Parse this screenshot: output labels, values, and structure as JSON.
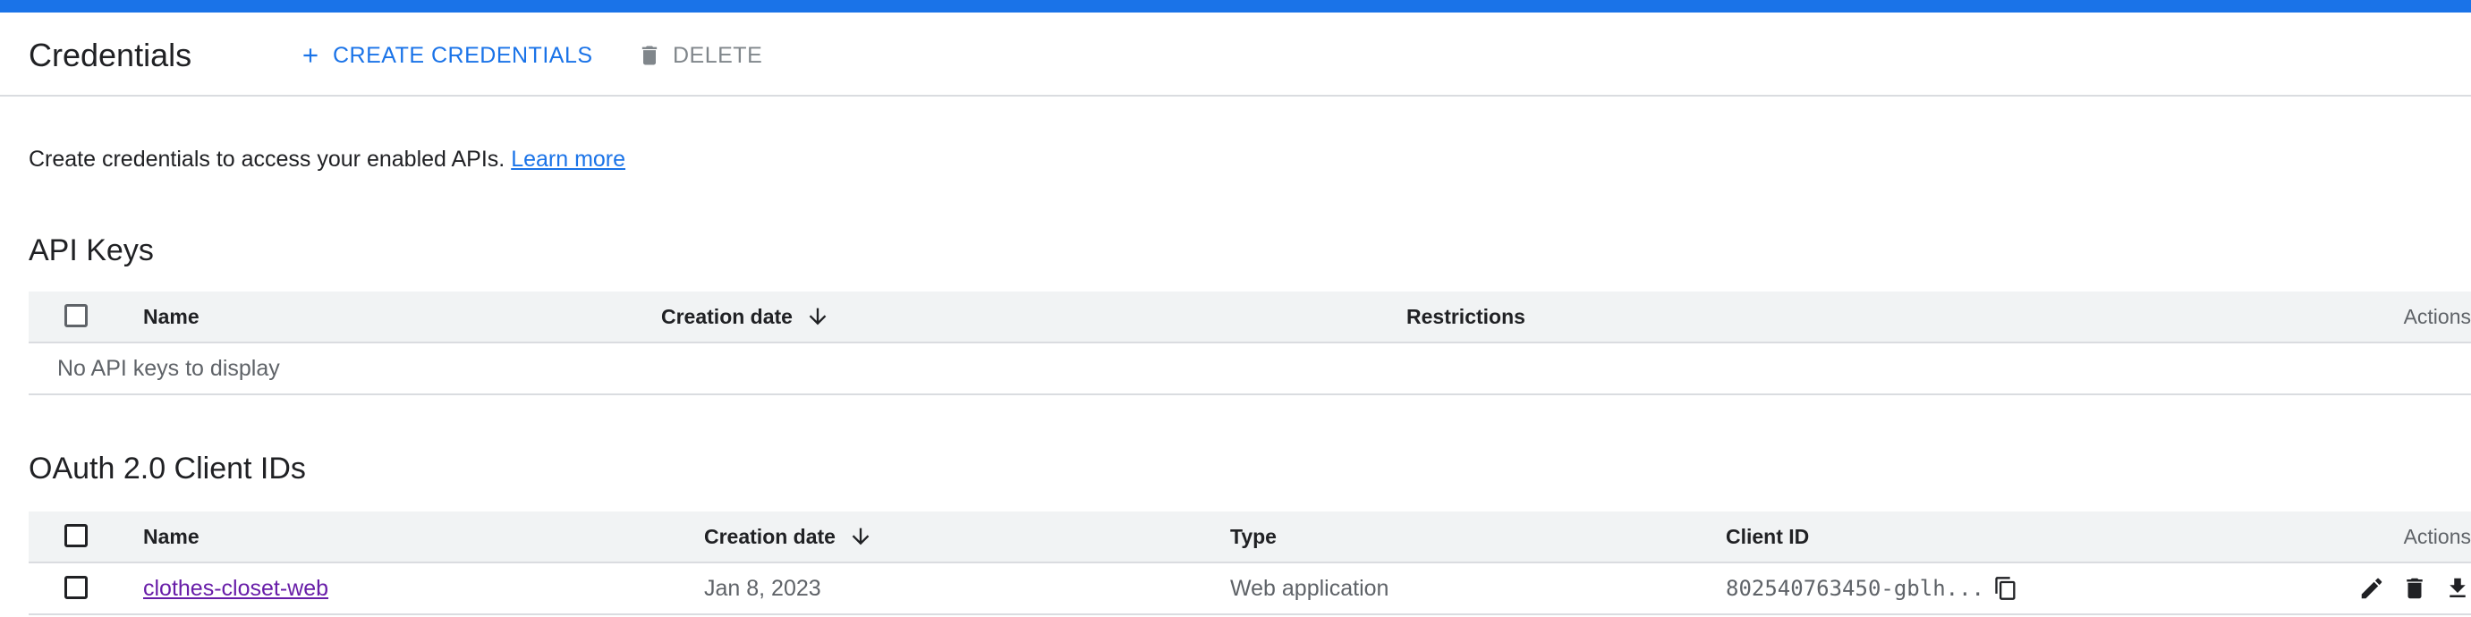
{
  "header": {
    "title": "Credentials",
    "create_label": "CREATE CREDENTIALS",
    "delete_label": "DELETE"
  },
  "intro": {
    "text": "Create credentials to access your enabled APIs. ",
    "link": "Learn more"
  },
  "api_keys": {
    "title": "API Keys",
    "columns": {
      "name": "Name",
      "creation_date": "Creation date",
      "restrictions": "Restrictions",
      "actions": "Actions"
    },
    "empty_text": "No API keys to display"
  },
  "oauth": {
    "title": "OAuth 2.0 Client IDs",
    "columns": {
      "name": "Name",
      "creation_date": "Creation date",
      "type": "Type",
      "client_id": "Client ID",
      "actions": "Actions"
    },
    "rows": [
      {
        "name": "clothes-closet-web",
        "creation_date": "Jan 8, 2023",
        "type": "Web application",
        "client_id": "802540763450-gblh..."
      }
    ]
  },
  "icons": {
    "create": "plus-icon",
    "delete": "trash-icon",
    "sort": "arrow-down-icon",
    "copy": "copy-icon",
    "edit": "pencil-icon",
    "row_delete": "trash-icon",
    "download": "download-icon"
  },
  "colors": {
    "accent": "#1a73e8",
    "visited_link": "#681da8",
    "header_bg": "#f1f3f4"
  }
}
